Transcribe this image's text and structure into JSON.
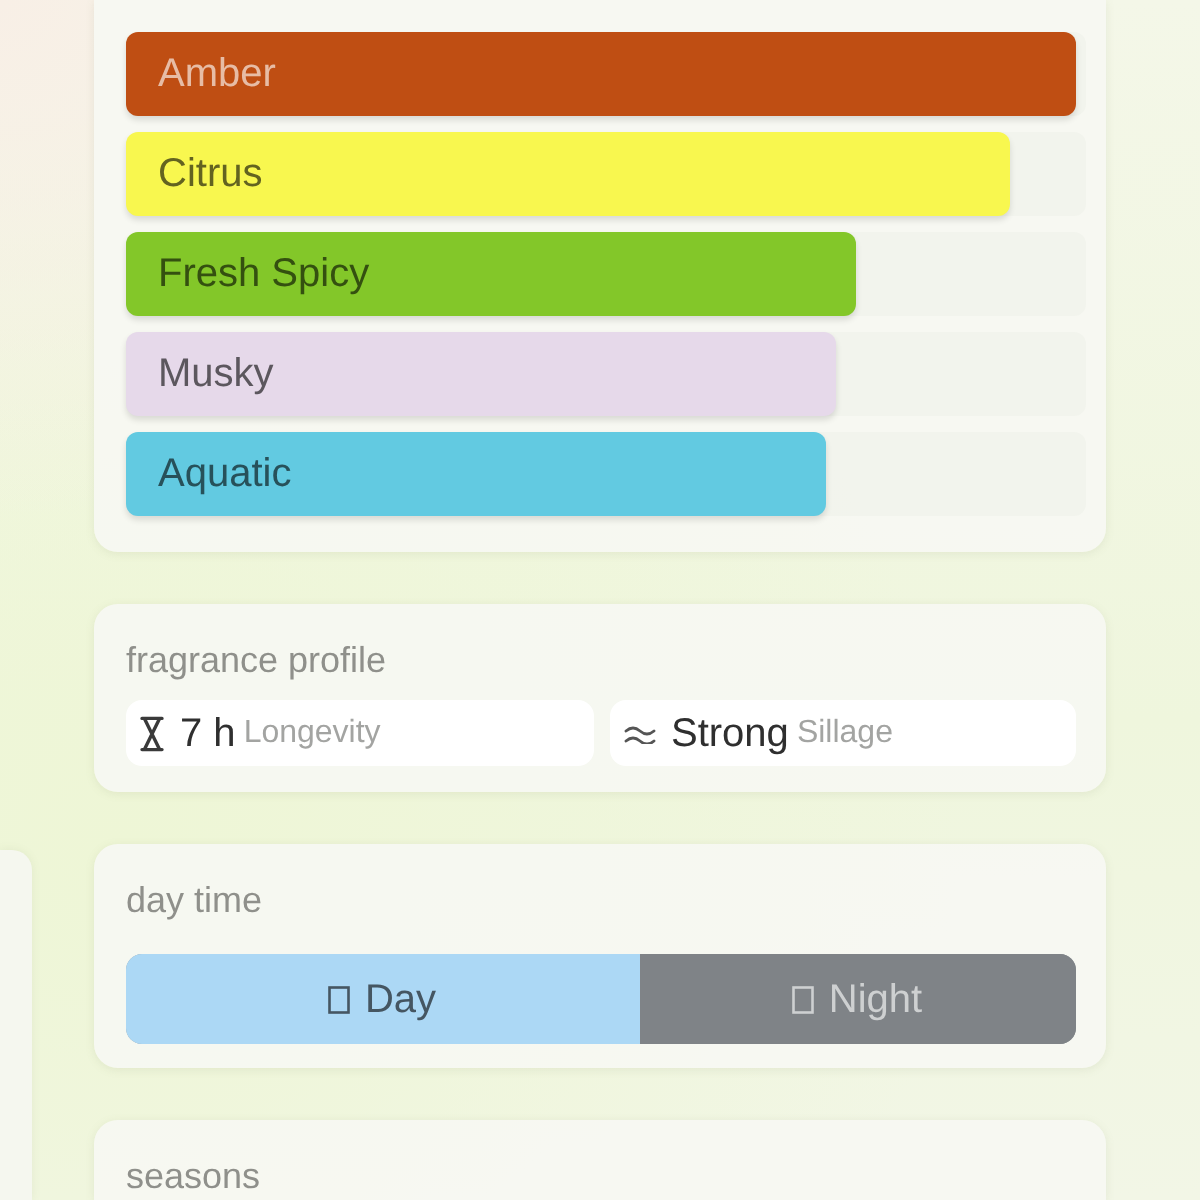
{
  "accords": [
    {
      "name": "Amber",
      "level": 0.99,
      "color": "#bf4e13"
    },
    {
      "name": "Citrus",
      "level": 0.92,
      "color": "#f8f74f"
    },
    {
      "name": "Fresh Spicy",
      "level": 0.76,
      "color": "#83c729"
    },
    {
      "name": "Musky",
      "level": 0.74,
      "color": "#e6d9ea"
    },
    {
      "name": "Aquatic",
      "level": 0.73,
      "color": "#62cae1"
    }
  ],
  "fragrance_profile": {
    "title": "fragrance profile",
    "stats": [
      {
        "kind": "longevity",
        "value": "7 h",
        "label": "Longevity"
      },
      {
        "kind": "sillage",
        "value": "Strong",
        "label": "Sillage"
      }
    ]
  },
  "day_time": {
    "title": "day time",
    "segments": [
      {
        "label": "Day",
        "level": 0.54,
        "color": "#acd8f5"
      },
      {
        "label": "Night",
        "level": 0.46,
        "color": "#7f8387"
      }
    ]
  },
  "seasons": {
    "title": "seasons"
  }
}
